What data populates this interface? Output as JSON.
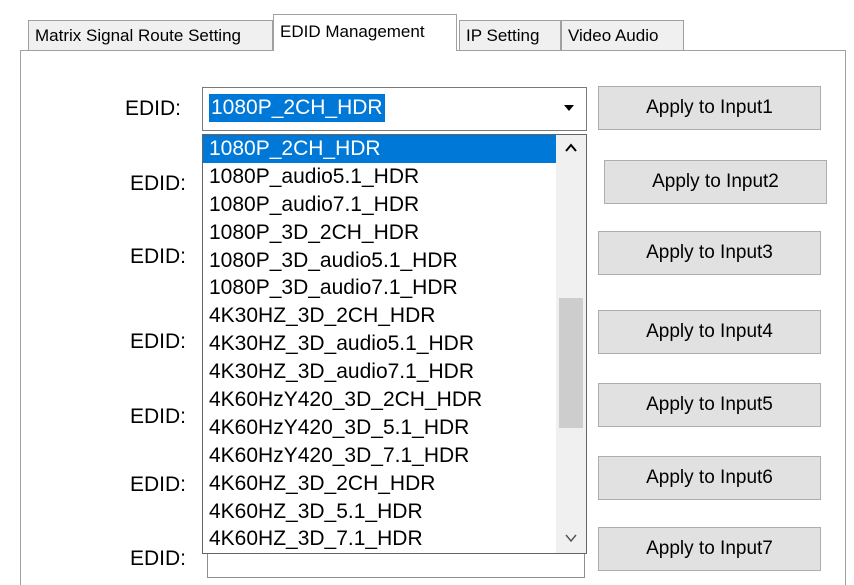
{
  "tabs": [
    {
      "label": "Matrix Signal Route Setting"
    },
    {
      "label": "EDID Management"
    },
    {
      "label": "IP Setting"
    },
    {
      "label": "Video Audio"
    }
  ],
  "edid_label": "EDID:",
  "combo": {
    "value": "1080P_2CH_HDR",
    "arrow_icon": "chevron-down-icon"
  },
  "buttons": [
    "Apply to Input1",
    "Apply to Input2",
    "Apply to Input3",
    "Apply to Input4",
    "Apply to Input5",
    "Apply to Input6",
    "Apply to Input7"
  ],
  "dropdown": {
    "selected_index": 0,
    "items": [
      "1080P_2CH_HDR",
      "1080P_audio5.1_HDR",
      "1080P_audio7.1_HDR",
      "1080P_3D_2CH_HDR",
      "1080P_3D_audio5.1_HDR",
      "1080P_3D_audio7.1_HDR",
      "4K30HZ_3D_2CH_HDR",
      "4K30HZ_3D_audio5.1_HDR",
      "4K30HZ_3D_audio7.1_HDR",
      "4K60HzY420_3D_2CH_HDR",
      "4K60HzY420_3D_5.1_HDR",
      "4K60HzY420_3D_7.1_HDR",
      "4K60HZ_3D_2CH_HDR",
      "4K60HZ_3D_5.1_HDR",
      "4K60HZ_3D_7.1_HDR"
    ]
  }
}
